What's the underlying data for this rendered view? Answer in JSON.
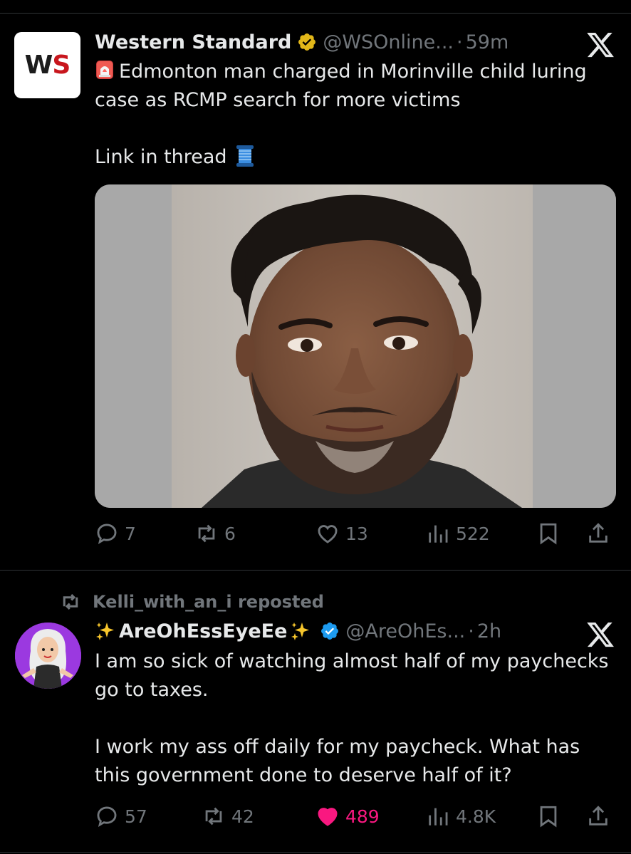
{
  "tweets": [
    {
      "avatar_text_left": "W",
      "avatar_text_right": "S",
      "name": "Western Standard",
      "handle": "@WSOnline...",
      "dot": "·",
      "time": "59m",
      "text_line1": "Edmonton man charged in Morinville child luring case as RCMP search for more victims",
      "text_line2": "Link in thread",
      "stats": {
        "replies": "7",
        "reposts": "6",
        "likes": "13",
        "views": "522"
      }
    },
    {
      "repost_label": "Kelli_with_an_i reposted",
      "name": "AreOhEssEyeEe",
      "handle": "@AreOhEs...",
      "dot": "·",
      "time": "2h",
      "paragraph1": "I am so sick of watching almost half of my paychecks go to taxes.",
      "paragraph2": "I work my ass off daily for my paycheck. What has this government done to deserve half of it?",
      "stats": {
        "replies": "57",
        "reposts": "42",
        "likes": "489",
        "views": "4.8K"
      }
    }
  ],
  "icons": {
    "verified_badge": "gold-verified-badge-icon",
    "verified_badge_blue": "blue-verified-badge-icon",
    "close": "x-logo-icon",
    "reply": "reply-icon",
    "repost": "repost-icon",
    "like": "heart-icon",
    "views": "views-icon",
    "bookmark": "bookmark-icon",
    "share": "share-icon"
  },
  "colors": {
    "background": "#000000",
    "text_primary": "#e7e9ea",
    "text_secondary": "#71767b",
    "like_active": "#f91880",
    "verified_gold": "#e2b719",
    "verified_blue": "#1d9bf0",
    "ws_red": "#c8161d",
    "bitmoji_bg": "#9b39e0"
  }
}
